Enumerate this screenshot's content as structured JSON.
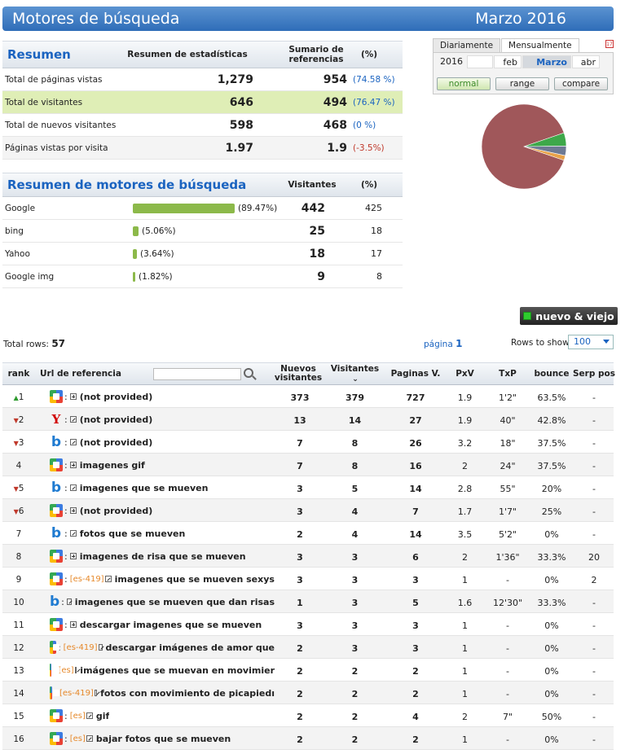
{
  "header": {
    "title": "Motores de búsqueda",
    "period": "Marzo 2016"
  },
  "summary": {
    "title": "Resumen",
    "col_stats": "Resumen de estadísticas",
    "col_ref": "Sumario de referencias",
    "col_pct": "(%)",
    "rows": [
      {
        "label": "Total de páginas vistas",
        "v1": "1,279",
        "v2": "954",
        "pct": "(74.58 %)"
      },
      {
        "label": "Total de visitantes",
        "v1": "646",
        "v2": "494",
        "pct": "(76.47 %)"
      },
      {
        "label": "Total de nuevos visitantes",
        "v1": "598",
        "v2": "468",
        "pct": "(0 %)"
      },
      {
        "label": "Páginas vistas por visita",
        "v1": "1.97",
        "v2": "1.9",
        "pct": "(-3.5%)"
      }
    ]
  },
  "engines": {
    "title": "Resumen de motores de búsqueda",
    "col_visitors": "Visitantes",
    "col_pct": "(%)",
    "rows": [
      {
        "label": "Google",
        "share": 0.8947,
        "pct": "(89.47%)",
        "v1": "442",
        "v2": "425"
      },
      {
        "label": "bing",
        "share": 0.0506,
        "pct": "(5.06%)",
        "v1": "25",
        "v2": "18"
      },
      {
        "label": "Yahoo",
        "share": 0.0364,
        "pct": "(3.64%)",
        "v1": "18",
        "v2": "17"
      },
      {
        "label": "Google img",
        "share": 0.0182,
        "pct": "(1.82%)",
        "v1": "9",
        "v2": "8"
      }
    ]
  },
  "picker": {
    "tabs": [
      "Diariamente",
      "Mensualmente"
    ],
    "year": "2016",
    "months": [
      "",
      "feb",
      "Marzo",
      "abr"
    ],
    "modes": [
      "normal",
      "range",
      "compare"
    ]
  },
  "pie_colors": {
    "google": "#a0575a",
    "bing": "#3ea84a",
    "yahoo": "#6e7a94",
    "googleimg": "#e8a24a"
  },
  "nv_button": "nuevo & viejo",
  "meta": {
    "total_label": "Total rows:",
    "total_value": "57",
    "page_label": "página",
    "page_value": "1",
    "rows_label": "Rows to show",
    "rows_value": "100"
  },
  "table": {
    "headers": {
      "rank": "rank",
      "url": "Url de referencia",
      "nv": "Nuevos visitantes",
      "vis": "Visitantes",
      "pv": "Paginas V.",
      "pxv": "PxV",
      "txp": "TxP",
      "bounce": "bounce",
      "serp": "Serp pos"
    },
    "rows": [
      {
        "rank": "1",
        "trend": "up",
        "engine": "g",
        "tag": "",
        "box": "plus",
        "kw": "(not provided)",
        "nv": "373",
        "vis": "379",
        "pv": "727",
        "pxv": "1.9",
        "txp": "1'2\"",
        "bounce": "63.5%",
        "serp": "-"
      },
      {
        "rank": "2",
        "trend": "down",
        "engine": "y",
        "tag": "",
        "box": "ext",
        "kw": "(not provided)",
        "nv": "13",
        "vis": "14",
        "pv": "27",
        "pxv": "1.9",
        "txp": "40\"",
        "bounce": "42.8%",
        "serp": "-"
      },
      {
        "rank": "3",
        "trend": "down",
        "engine": "b",
        "tag": "",
        "box": "ext",
        "kw": "(not provided)",
        "nv": "7",
        "vis": "8",
        "pv": "26",
        "pxv": "3.2",
        "txp": "18\"",
        "bounce": "37.5%",
        "serp": "-"
      },
      {
        "rank": "4",
        "trend": "",
        "engine": "g",
        "tag": "",
        "box": "plus",
        "kw": "imagenes gif",
        "nv": "7",
        "vis": "8",
        "pv": "16",
        "pxv": "2",
        "txp": "24\"",
        "bounce": "37.5%",
        "serp": "-"
      },
      {
        "rank": "5",
        "trend": "down",
        "engine": "b",
        "tag": "",
        "box": "ext",
        "kw": "imagenes que se mueven",
        "nv": "3",
        "vis": "5",
        "pv": "14",
        "pxv": "2.8",
        "txp": "55\"",
        "bounce": "20%",
        "serp": "-"
      },
      {
        "rank": "6",
        "trend": "down",
        "engine": "g",
        "tag": "",
        "box": "plus",
        "kw": "(not provided)",
        "nv": "3",
        "vis": "4",
        "pv": "7",
        "pxv": "1.7",
        "txp": "1'7\"",
        "bounce": "25%",
        "serp": "-"
      },
      {
        "rank": "7",
        "trend": "",
        "engine": "b",
        "tag": "",
        "box": "ext",
        "kw": "fotos que se mueven",
        "nv": "2",
        "vis": "4",
        "pv": "14",
        "pxv": "3.5",
        "txp": "5'2\"",
        "bounce": "0%",
        "serp": "-"
      },
      {
        "rank": "8",
        "trend": "",
        "engine": "g",
        "tag": "",
        "box": "plus",
        "kw": "imagenes de risa que se mueven",
        "nv": "3",
        "vis": "3",
        "pv": "6",
        "pxv": "2",
        "txp": "1'36\"",
        "bounce": "33.3%",
        "serp": "20"
      },
      {
        "rank": "9",
        "trend": "",
        "engine": "g",
        "tag": "[es-419]",
        "box": "ext",
        "kw": "imagenes que se mueven sexys",
        "nv": "3",
        "vis": "3",
        "pv": "3",
        "pxv": "1",
        "txp": "-",
        "bounce": "0%",
        "serp": "2"
      },
      {
        "rank": "10",
        "trend": "",
        "engine": "b",
        "tag": "",
        "box": "ext",
        "kw": "imagenes que se mueven que dan risas",
        "nv": "1",
        "vis": "3",
        "pv": "5",
        "pxv": "1.6",
        "txp": "12'30\"",
        "bounce": "33.3%",
        "serp": "-"
      },
      {
        "rank": "11",
        "trend": "",
        "engine": "g",
        "tag": "",
        "box": "plus",
        "kw": "descargar imagenes que se mueven",
        "nv": "3",
        "vis": "3",
        "pv": "3",
        "pxv": "1",
        "txp": "-",
        "bounce": "0%",
        "serp": "-"
      },
      {
        "rank": "12",
        "trend": "",
        "engine": "g",
        "tag": "[es-419]",
        "box": "ext",
        "kw": "descargar imágenes de amor que",
        "nv": "2",
        "vis": "3",
        "pv": "3",
        "pxv": "1",
        "txp": "-",
        "bounce": "0%",
        "serp": "-"
      },
      {
        "rank": "13",
        "trend": "",
        "engine": "g",
        "tag": "[es]",
        "box": "ext",
        "kw": "imágenes que se muevan en movimier",
        "nv": "2",
        "vis": "2",
        "pv": "2",
        "pxv": "1",
        "txp": "-",
        "bounce": "0%",
        "serp": "-"
      },
      {
        "rank": "14",
        "trend": "",
        "engine": "g",
        "tag": "[es-419]",
        "box": "ext",
        "kw": "fotos con movimiento de picapiedı",
        "nv": "2",
        "vis": "2",
        "pv": "2",
        "pxv": "1",
        "txp": "-",
        "bounce": "0%",
        "serp": "-"
      },
      {
        "rank": "15",
        "trend": "",
        "engine": "g",
        "tag": "[es]",
        "box": "ext",
        "kw": "gif",
        "nv": "2",
        "vis": "2",
        "pv": "4",
        "pxv": "2",
        "txp": "7\"",
        "bounce": "50%",
        "serp": "-"
      },
      {
        "rank": "16",
        "trend": "",
        "engine": "g",
        "tag": "[es]",
        "box": "ext",
        "kw": "bajar fotos que se mueven",
        "nv": "2",
        "vis": "2",
        "pv": "2",
        "pxv": "1",
        "txp": "-",
        "bounce": "0%",
        "serp": "-"
      }
    ]
  }
}
